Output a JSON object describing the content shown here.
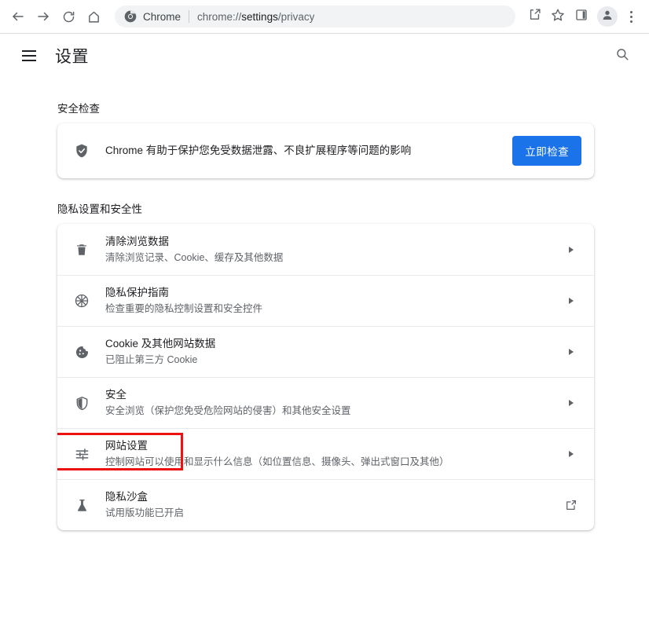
{
  "browser": {
    "nav": {
      "back_icon": "back-arrow-icon",
      "forward_icon": "forward-arrow-icon",
      "reload_icon": "reload-icon",
      "home_icon": "home-icon"
    },
    "omnibox": {
      "site_icon": "chrome-logo-icon",
      "chip_label": "Chrome",
      "url_prefix": "chrome://",
      "url_strong": "settings",
      "url_suffix": "/privacy",
      "full_url": "chrome://settings/privacy"
    },
    "actions": {
      "share_icon": "share-icon",
      "bookmark_icon": "star-icon",
      "side_panel_icon": "side-panel-icon",
      "profile_icon": "profile-avatar-icon",
      "menu_icon": "three-dot-menu-icon"
    }
  },
  "settings": {
    "menu_icon": "hamburger-menu-icon",
    "title": "设置",
    "search_icon": "search-icon"
  },
  "safety_check": {
    "section_label": "安全检查",
    "icon": "shield-check-icon",
    "description": "Chrome 有助于保护您免受数据泄露、不良扩展程序等问题的影响",
    "button_label": "立即检查",
    "button_color": "#1a73e8"
  },
  "privacy": {
    "section_label": "隐私设置和安全性",
    "rows": [
      {
        "icon": "trash-icon",
        "title": "清除浏览数据",
        "subtitle": "清除浏览记录、Cookie、缓存及其他数据",
        "end_icon": "chevron-right-icon",
        "highlighted": false
      },
      {
        "icon": "privacy-guide-icon",
        "title": "隐私保护指南",
        "subtitle": "检查重要的隐私控制设置和安全控件",
        "end_icon": "chevron-right-icon",
        "highlighted": false
      },
      {
        "icon": "cookie-icon",
        "title": "Cookie 及其他网站数据",
        "subtitle": "已阻止第三方 Cookie",
        "end_icon": "chevron-right-icon",
        "highlighted": false
      },
      {
        "icon": "shield-icon",
        "title": "安全",
        "subtitle": "安全浏览（保护您免受危险网站的侵害）和其他安全设置",
        "end_icon": "chevron-right-icon",
        "highlighted": false
      },
      {
        "icon": "tune-sliders-icon",
        "title": "网站设置",
        "subtitle": "控制网站可以使用和显示什么信息（如位置信息、摄像头、弹出式窗口及其他）",
        "end_icon": "chevron-right-icon",
        "highlighted": true
      },
      {
        "icon": "flask-icon",
        "title": "隐私沙盒",
        "subtitle": "试用版功能已开启",
        "end_icon": "external-link-icon",
        "highlighted": false
      }
    ]
  },
  "annotation": {
    "highlight_color": "#ee1111",
    "target": "网站设置"
  }
}
